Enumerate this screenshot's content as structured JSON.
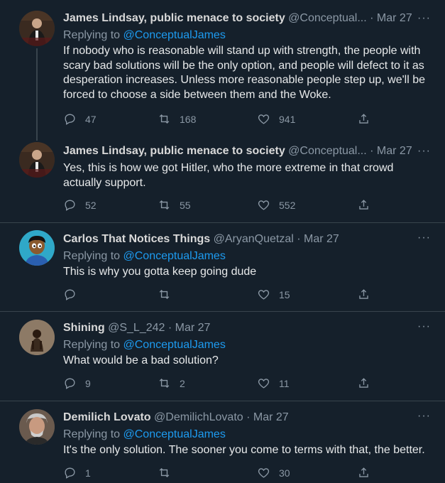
{
  "tweets": [
    {
      "name": "James Lindsay, public menace to society",
      "handle": "@Conceptual...",
      "date": "· Mar 27",
      "more": "···",
      "replying_prefix": "Replying to ",
      "replying_to": "@ConceptualJames",
      "text": "If nobody who is reasonable will stand up with strength, the people with scary bad solutions will be the only option, and people will defect to it as desperation increases. Unless more reasonable people step up, we'll be forced to choose a side between them and the Woke.",
      "replies": "47",
      "retweets": "168",
      "likes": "941"
    },
    {
      "name": "James Lindsay, public menace to society",
      "handle": "@Conceptual...",
      "date": "· Mar 27",
      "more": "···",
      "text": "Yes, this is how we got Hitler, who the more extreme in that crowd actually support.",
      "replies": "52",
      "retweets": "55",
      "likes": "552"
    },
    {
      "name": "Carlos That Notices Things",
      "handle": "@AryanQuetzal",
      "date": "· Mar 27",
      "more": "···",
      "replying_prefix": "Replying to ",
      "replying_to": "@ConceptualJames",
      "text": "This is why you gotta keep going dude",
      "replies": "",
      "retweets": "",
      "likes": "15"
    },
    {
      "name": "Shining",
      "handle": "@S_L_242",
      "date": "· Mar 27",
      "more": "···",
      "replying_prefix": "Replying to ",
      "replying_to": "@ConceptualJames",
      "text": "What would be a bad solution?",
      "replies": "9",
      "retweets": "2",
      "likes": "11"
    },
    {
      "name": "Demilich Lovato",
      "handle": "@DemilichLovato",
      "date": "· Mar 27",
      "more": "···",
      "replying_prefix": "Replying to ",
      "replying_to": "@ConceptualJames",
      "text": "It's the only solution. The sooner you come to terms with that, the better.",
      "replies": "1",
      "retweets": "",
      "likes": "30"
    }
  ],
  "colors": {
    "background": "#15202b",
    "link": "#1d9bf0",
    "muted": "#8b98a5",
    "divider": "#38444d"
  },
  "icons": [
    "reply-icon",
    "retweet-icon",
    "like-icon",
    "share-icon",
    "more-icon"
  ]
}
